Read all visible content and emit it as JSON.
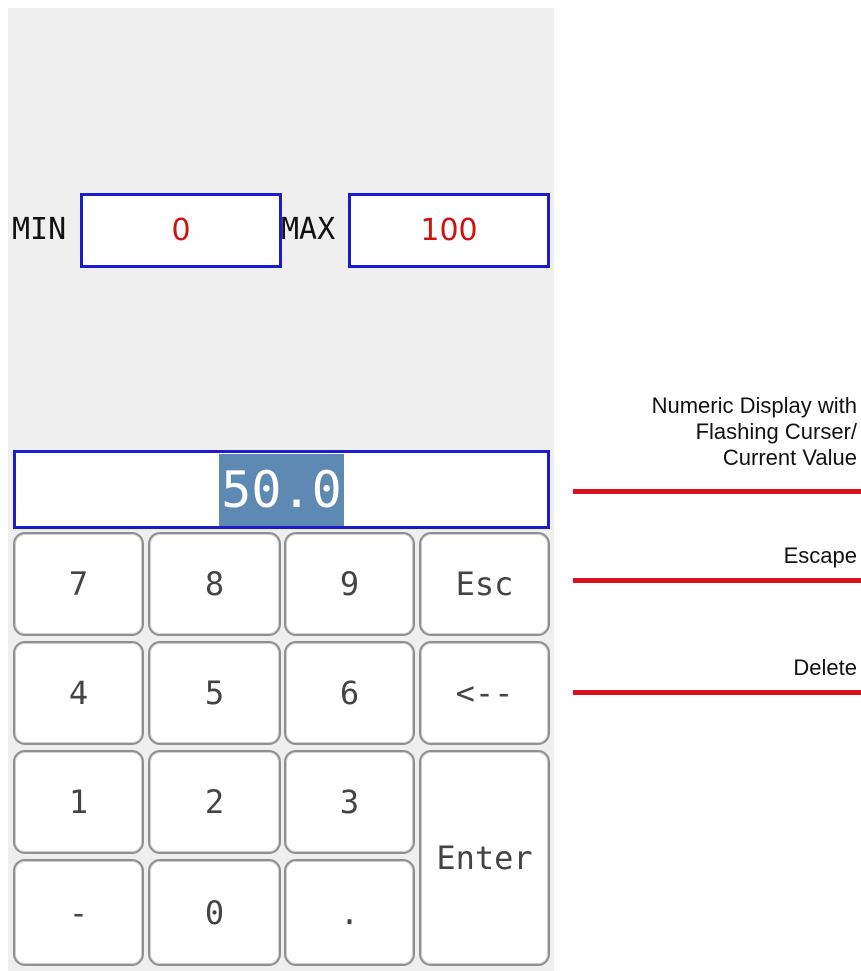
{
  "limits": {
    "min_label": "MIN",
    "min_value": "0",
    "max_label": "MAX",
    "max_value": "100"
  },
  "display": {
    "value": "50.0"
  },
  "keypad": {
    "k7": "7",
    "k8": "8",
    "k9": "9",
    "esc": "Esc",
    "k4": "4",
    "k5": "5",
    "k6": "6",
    "delete": "<--",
    "k1": "1",
    "k2": "2",
    "k3": "3",
    "enter": "Enter",
    "minus": "-",
    "k0": "0",
    "dot": "."
  },
  "annotations": {
    "display_line1": "Numeric Display with",
    "display_line2": "Flashing Curser/",
    "display_line3": "Current Value",
    "escape": "Escape",
    "delete": "Delete"
  },
  "colors": {
    "border_blue": "#1c1ccc",
    "value_red": "#d11010",
    "highlight": "#5d89b2",
    "annotation_line": "#d8121c"
  }
}
